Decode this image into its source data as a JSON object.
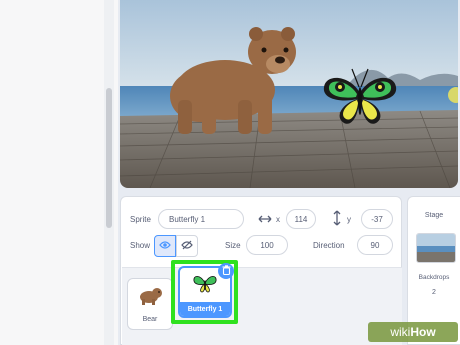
{
  "sprite_info": {
    "sprite_label": "Sprite",
    "sprite_name": "Butterfly 1",
    "x_label": "x",
    "x_value": "114",
    "y_label": "y",
    "y_value": "-37",
    "show_label": "Show",
    "size_label": "Size",
    "size_value": "100",
    "direction_label": "Direction",
    "direction_value": "90"
  },
  "sprites": [
    {
      "name": "Bear",
      "selected": false
    },
    {
      "name": "Butterfly 1",
      "selected": true
    }
  ],
  "stage_pane": {
    "title": "Stage",
    "backdrops_label": "Backdrops",
    "backdrops_count": "2"
  },
  "watermark": {
    "part1": "wiki",
    "part2": "How"
  },
  "colors": {
    "accent": "#4c97ff",
    "highlight": "#2fe11f",
    "text": "#575e75"
  },
  "icons": [
    "eye-icon",
    "eye-slash-icon",
    "horizontal-arrows-icon",
    "vertical-arrows-icon",
    "trash-icon",
    "bear-sprite-icon",
    "butterfly-sprite-icon"
  ]
}
